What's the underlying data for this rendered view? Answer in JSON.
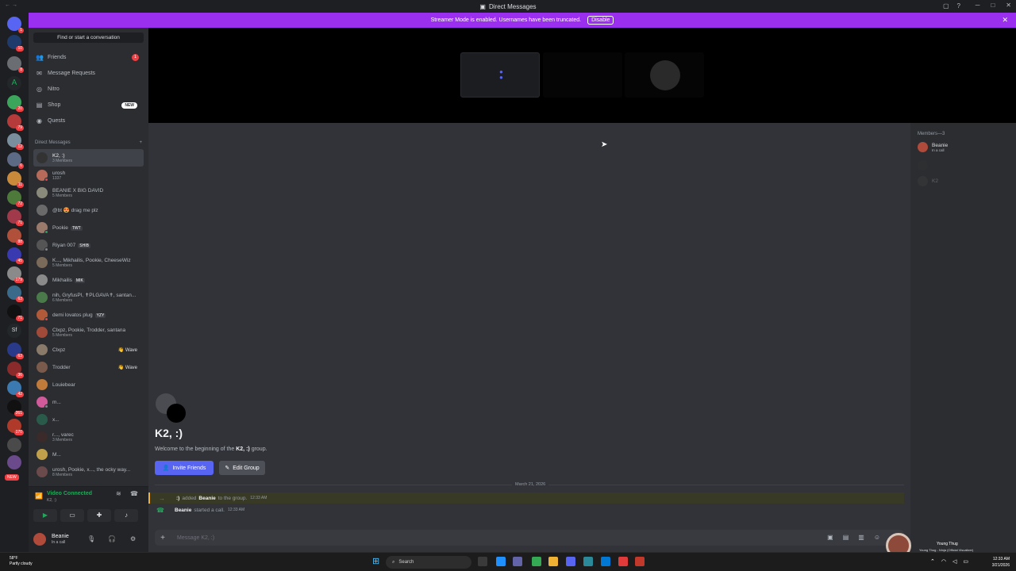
{
  "window": {
    "title": "Direct Messages",
    "controls": [
      "─",
      "□",
      "✕"
    ]
  },
  "banner": {
    "text": "Streamer Mode is enabled. Usernames have been truncated.",
    "button": "Disable"
  },
  "guild_badges": [
    "1",
    "10",
    "8",
    "20",
    "79",
    "12",
    "6",
    "11",
    "72",
    "71",
    "88",
    "45",
    "179",
    "63",
    "71",
    "63",
    "36",
    "42",
    "261",
    "170",
    "NEW"
  ],
  "sidebar": {
    "find_placeholder": "Find or start a conversation",
    "nav": [
      {
        "label": "Friends",
        "icon": "friends-icon",
        "badge": "1"
      },
      {
        "label": "Message Requests",
        "icon": "envelope-icon"
      },
      {
        "label": "Nitro",
        "icon": "nitro-icon"
      },
      {
        "label": "Shop",
        "icon": "shop-icon",
        "badge_new": "NEW"
      },
      {
        "label": "Quests",
        "icon": "quests-icon"
      }
    ],
    "dm_header": "Direct Messages",
    "dms": [
      {
        "name": "K2, :)",
        "sub": "3 Members",
        "active": true
      },
      {
        "name": "urosh",
        "sub": "1337"
      },
      {
        "name": "BEANIE X BIG DAVID",
        "sub": "5 Members"
      },
      {
        "name": "@bt 😍 drag me plz",
        "sub": ""
      },
      {
        "name": "Pookie",
        "sub": "",
        "tag": "TWT"
      },
      {
        "name": "Riyan 007",
        "sub": "",
        "tag": "SHIB"
      },
      {
        "name": "K..., Mikhailis, Pookie, CheeseWiz",
        "sub": "5 Members"
      },
      {
        "name": "Mikhailis",
        "sub": "",
        "tag": "MIK"
      },
      {
        "name": "nih, GryfusPl, ✝PLGAVA✝, santan...",
        "sub": "6 Members"
      },
      {
        "name": "demi lovatos plug",
        "sub": "",
        "tag": "YZY"
      },
      {
        "name": "Clxpz, Pookie, Trodder, santana",
        "sub": "5 Members"
      },
      {
        "name": "Clxpz",
        "sub": "",
        "wave": "Wave"
      },
      {
        "name": "Trodder",
        "sub": "",
        "wave": "Wave"
      },
      {
        "name": "Louiebear",
        "sub": ""
      },
      {
        "name": "m...",
        "sub": ""
      },
      {
        "name": "x...",
        "sub": ""
      },
      {
        "name": "r..., varec",
        "sub": "3 Members"
      },
      {
        "name": "M...",
        "sub": ""
      },
      {
        "name": "urosh, Pookie, x..., the ocky way...",
        "sub": "8 Members"
      }
    ]
  },
  "voice": {
    "title": "Video Connected",
    "sub": "K2, :)"
  },
  "user": {
    "name": "Beanie",
    "status": "In a call"
  },
  "channel": {
    "title": "K2, :)",
    "welcome_prefix": "Welcome to the beginning of the",
    "welcome_group": "K2, :)",
    "welcome_suffix": "group.",
    "invite_label": "Invite Friends",
    "edit_label": "Edit Group",
    "date_divider": "March 21, 2026",
    "messages": [
      {
        "icon": "→",
        "actor": ":)",
        "text": "added",
        "target": "Beanie",
        "rest": "to the group.",
        "time": "12:33 AM"
      },
      {
        "icon": "📞",
        "actor": "Beanie",
        "text": "started a call.",
        "time": "12:33 AM"
      }
    ],
    "composer_placeholder": "Message K2, :)"
  },
  "members": {
    "header": "Members—3",
    "list": [
      {
        "name": "Beanie",
        "status": "In a call"
      },
      {
        "name": "",
        "status": ""
      },
      {
        "name": "K2",
        "status": ""
      }
    ]
  },
  "music": {
    "artist": "Young Thug",
    "song": "Young Thug - Ninja (Official Visualizer)"
  },
  "taskbar": {
    "weather_temp": "58°F",
    "weather_desc": "Partly cloudy",
    "search_label": "Search",
    "time": "12:33 AM",
    "date": "3/21/2026"
  }
}
